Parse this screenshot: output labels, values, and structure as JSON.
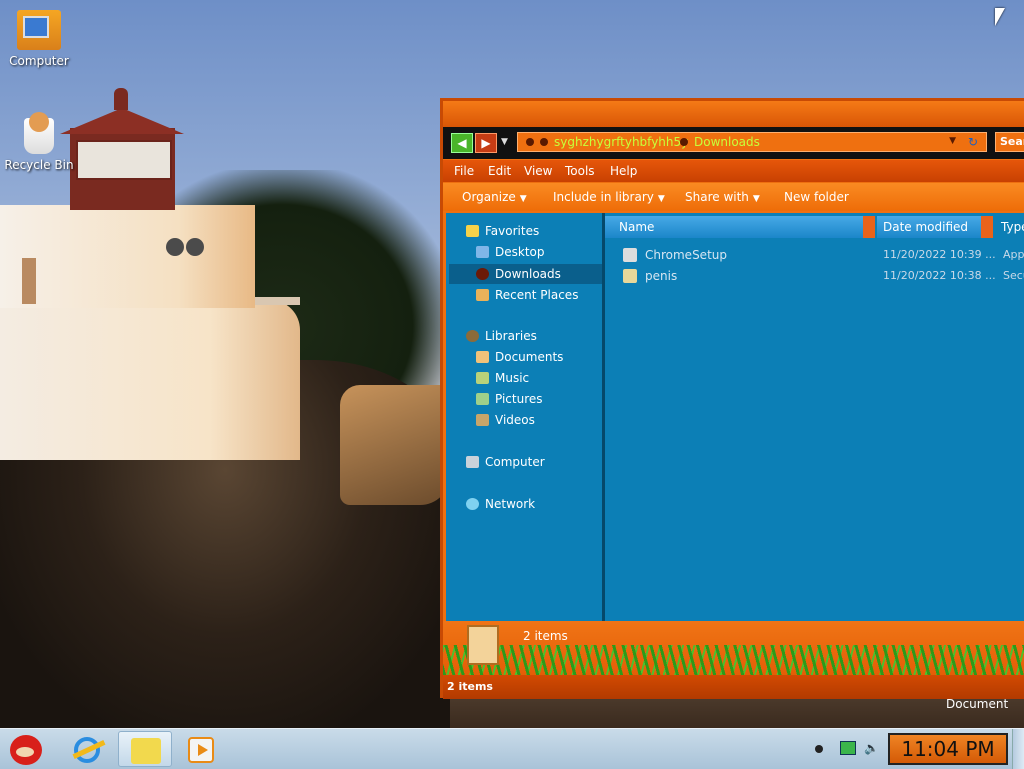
{
  "desktop": {
    "icons": [
      {
        "label": "Computer",
        "icon": "computer-icon"
      },
      {
        "label": "Recycle Bin",
        "icon": "recycle-bin-icon"
      }
    ]
  },
  "explorer": {
    "address": {
      "segments": [
        "syghzhygrftyhbfyhh5y",
        "Downloads"
      ]
    },
    "search": {
      "label": "Sear"
    },
    "menu": [
      "File",
      "Edit",
      "View",
      "Tools",
      "Help"
    ],
    "toolbar": {
      "organize": "Organize",
      "include_in_library": "Include in library",
      "share_with": "Share with",
      "new_folder": "New folder"
    },
    "nav": {
      "favorites": "Favorites",
      "desktop": "Desktop",
      "downloads": "Downloads",
      "recent_places": "Recent Places",
      "libraries": "Libraries",
      "documents": "Documents",
      "music": "Music",
      "pictures": "Pictures",
      "videos": "Videos",
      "computer": "Computer",
      "network": "Network"
    },
    "columns": {
      "name": "Name",
      "date_modified": "Date modified",
      "type": "Type"
    },
    "files": [
      {
        "name": "ChromeSetup",
        "date": "11/20/2022 10:39 ...",
        "type": "App"
      },
      {
        "name": "penis",
        "date": "11/20/2022 10:38 ...",
        "type": "Secu"
      }
    ],
    "details": {
      "count": "2 items"
    },
    "status": {
      "text": "2 items"
    }
  },
  "tooltip": "Document",
  "taskbar": {
    "apps": [
      "angry-birds-icon",
      "internet-explorer-icon",
      "windows-explorer-icon",
      "media-player-icon"
    ],
    "clock": "11:04 PM"
  },
  "colors": {
    "window_orange": "#ef7010",
    "pane_blue": "#0c7fb6",
    "address_text": "#c7ff3a"
  }
}
